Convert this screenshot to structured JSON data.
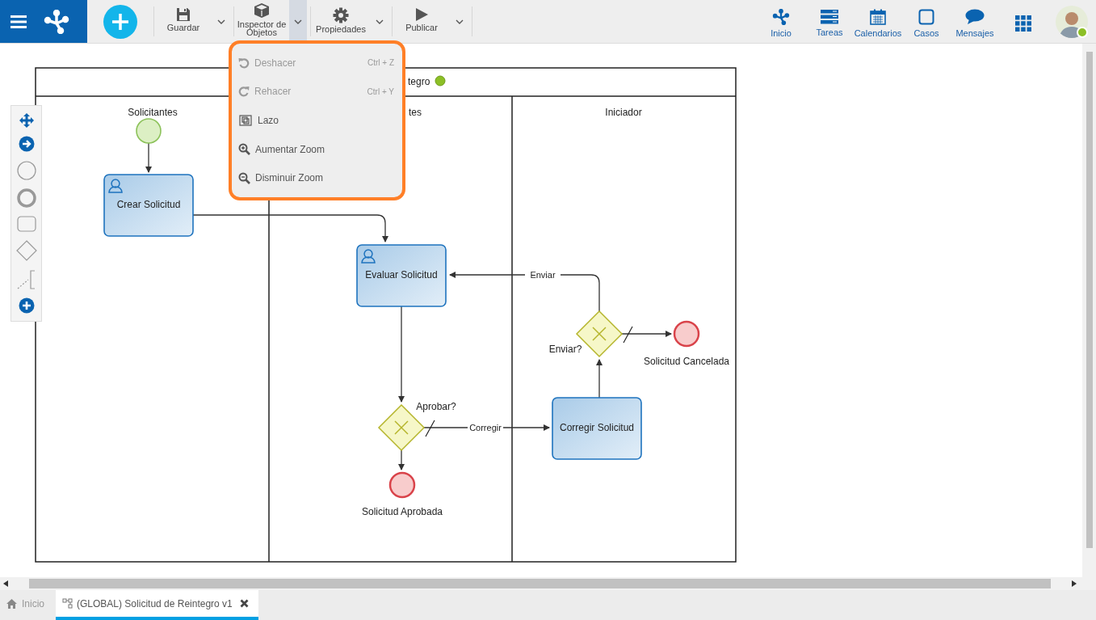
{
  "topbar": {
    "toolbar": [
      {
        "label": "Guardar",
        "expanded": false
      },
      {
        "label": "Inspector de Objetos",
        "expanded": true
      },
      {
        "label": "Propiedades",
        "expanded": false
      },
      {
        "label": "Publicar",
        "expanded": false
      }
    ],
    "nav": [
      {
        "label": "Inicio"
      },
      {
        "label": "Tareas"
      },
      {
        "label": "Calendarios"
      },
      {
        "label": "Casos"
      },
      {
        "label": "Mensajes"
      }
    ],
    "user": {
      "online": true
    }
  },
  "menu": [
    {
      "label": "Deshacer",
      "shortcut": "Ctrl + Z",
      "disabled": true
    },
    {
      "label": "Rehacer",
      "shortcut": "Ctrl + Y",
      "disabled": true
    },
    {
      "label": "Lazo",
      "disabled": false
    },
    {
      "label": "Aumentar Zoom",
      "disabled": false
    },
    {
      "label": "Disminuir Zoom",
      "disabled": false
    }
  ],
  "diagram": {
    "pool_title": "tegro",
    "lanes": [
      "Solicitantes",
      "tes",
      "Iniciador"
    ],
    "nodes": [
      {
        "kind": "start"
      },
      {
        "kind": "user_task",
        "label": "Crear Solicitud"
      },
      {
        "kind": "user_task",
        "label": "Evaluar Solicitud"
      },
      {
        "kind": "gateway",
        "label": "Aprobar?"
      },
      {
        "kind": "end",
        "label": "Solicitud Aprobada"
      },
      {
        "kind": "gateway",
        "label": "Enviar?"
      },
      {
        "kind": "task",
        "label": "Corregir Solicitud"
      },
      {
        "kind": "end",
        "label": "Solicitud Cancelada"
      }
    ],
    "flow_labels": [
      "Corregir",
      "Enviar"
    ]
  },
  "tabs": [
    {
      "label": "Inicio",
      "selected": false,
      "closable": false
    },
    {
      "label": "(GLOBAL) Solicitud de Reintegro v1",
      "selected": true,
      "closable": true
    }
  ]
}
